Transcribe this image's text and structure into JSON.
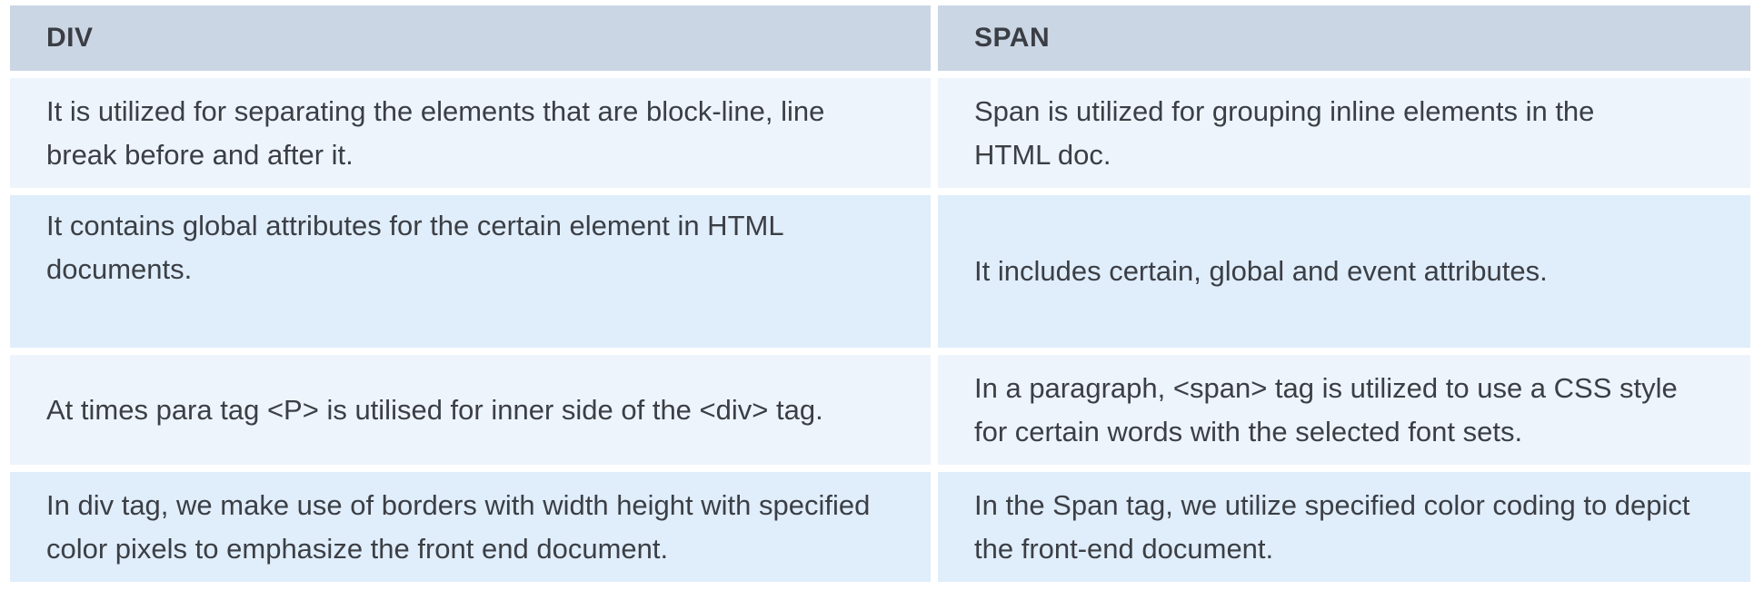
{
  "table": {
    "headers": [
      "DIV",
      "SPAN"
    ],
    "rows": [
      [
        "It is utilized for separating the elements that are block-line, line break before and after it.",
        "Span is utilized for grouping inline elements in the HTML doc."
      ],
      [
        "It contains global attributes for the certain element in HTML documents.",
        "It includes certain, global and event attributes."
      ],
      [
        "At times para tag <P> is utilised for inner side of the <div> tag.",
        "In a paragraph, <span> tag is utilized to use a CSS style for certain words with the selected font sets."
      ],
      [
        "In div tag, we make use of borders with width height with specified color pixels to emphasize the front end document.",
        "In the Span tag, we utilize specified color coding to depict the front-end document."
      ]
    ]
  },
  "colors": {
    "header_bg": "#cbd6e4",
    "row_odd_bg": "#eef4fc",
    "row_even_bg": "#e0edfb",
    "text": "#3b3f45"
  }
}
